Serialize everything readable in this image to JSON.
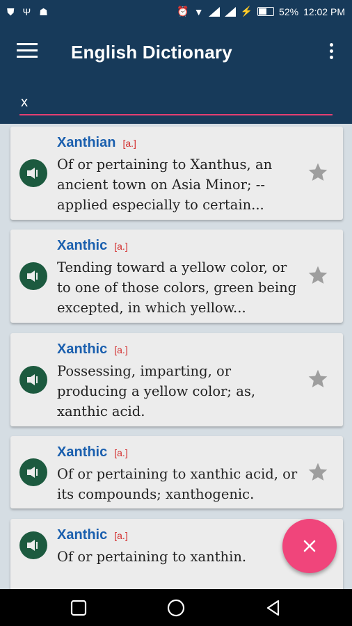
{
  "status_bar": {
    "battery": "52%",
    "battery_level": 0.52,
    "time": "12:02 PM"
  },
  "app_bar": {
    "title": "English Dictionary",
    "menu_icon": "hamburger-menu-icon",
    "overflow_icon": "more-vert-icon"
  },
  "search": {
    "value": "x"
  },
  "entries": [
    {
      "word": "Xanthian",
      "pos": "[a.]",
      "definition": "Of or pertaining to Xanthus, an ancient town on Asia   Minor; -- applied especially to certain..."
    },
    {
      "word": "Xanthic",
      "pos": "[a.]",
      "definition": "Tending toward a yellow color, or to one of those colors,   green being excepted, in which yellow..."
    },
    {
      "word": "Xanthic",
      "pos": "[a.]",
      "definition": "Possessing, imparting, or producing a yellow color; as, xanthic acid."
    },
    {
      "word": "Xanthic",
      "pos": "[a.]",
      "definition": "Of or pertaining to xanthic acid, or its compounds;   xanthogenic."
    },
    {
      "word": "Xanthic",
      "pos": "[a.]",
      "definition": "Of or pertaining to xanthin."
    }
  ],
  "fab": {
    "icon": "close-icon"
  },
  "colors": {
    "primary": "#173a5a",
    "accent": "#f0457b",
    "word": "#1a5fae",
    "pos": "#d32f2f",
    "speaker": "#1c5a3f"
  }
}
